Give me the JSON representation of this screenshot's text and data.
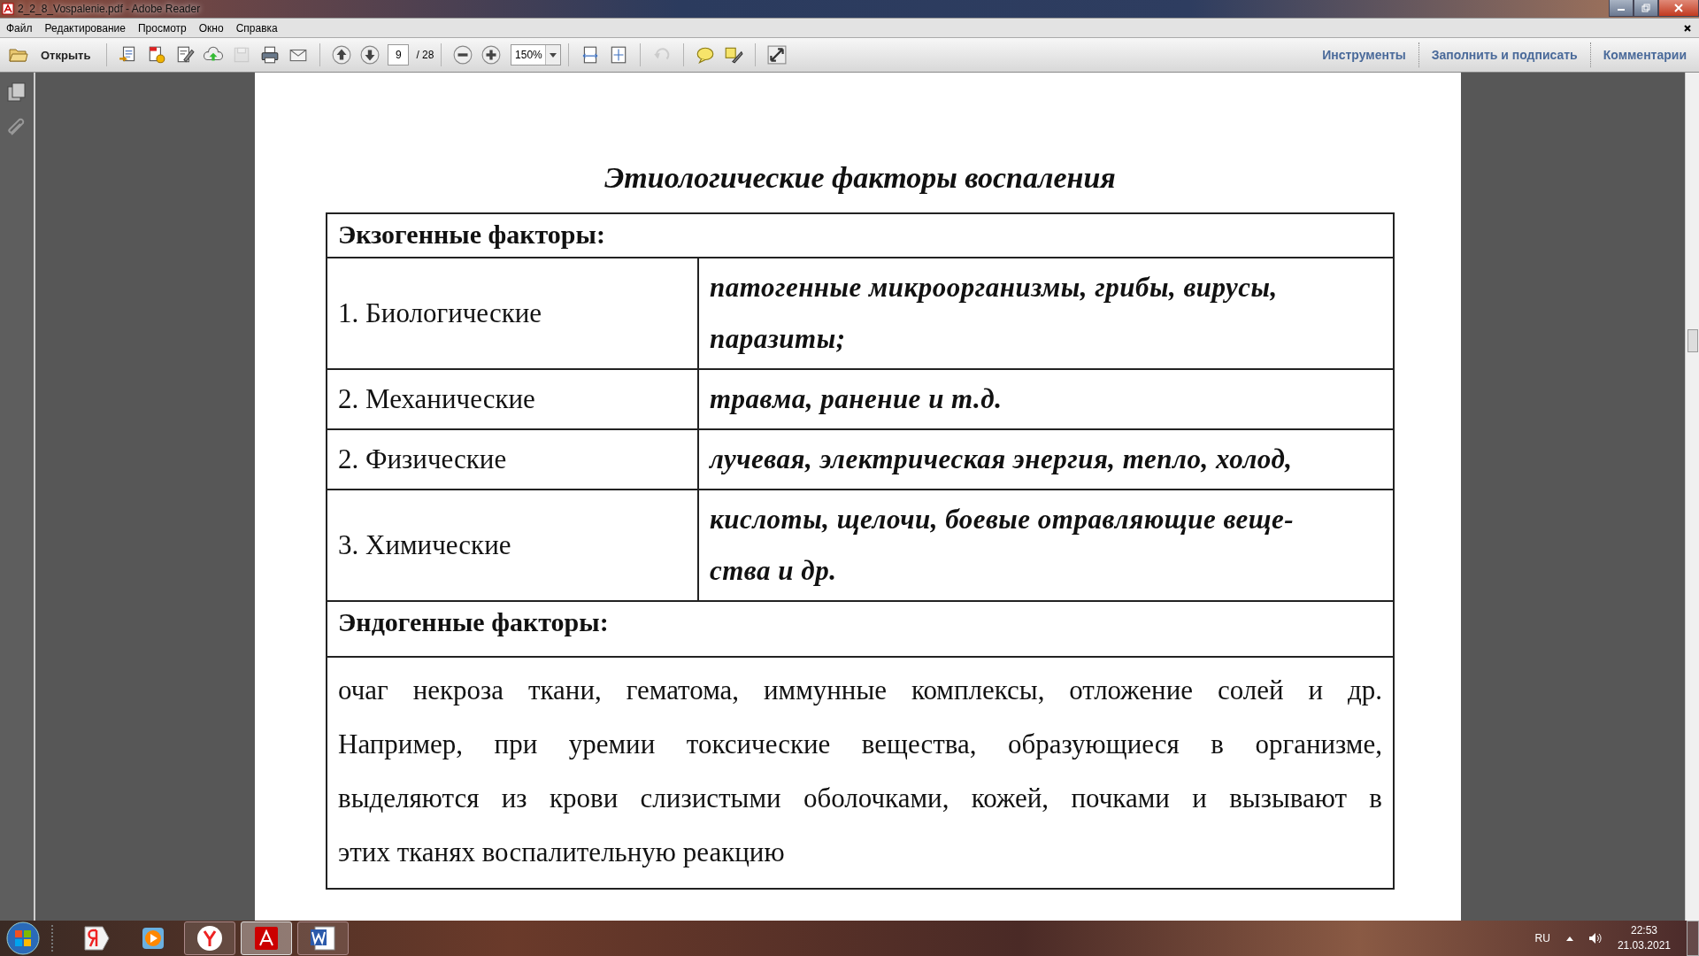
{
  "window": {
    "title": "2_2_8_Vospalenie.pdf - Adobe Reader"
  },
  "menu": [
    "Файл",
    "Редактирование",
    "Просмотр",
    "Окно",
    "Справка"
  ],
  "toolbar": {
    "open_label": "Открыть",
    "tools_a": [
      {
        "kind": "create",
        "disabled": false
      },
      {
        "kind": "convert",
        "disabled": false
      },
      {
        "kind": "edit",
        "disabled": false
      },
      {
        "kind": "upload",
        "disabled": false
      },
      {
        "kind": "save",
        "disabled": true
      },
      {
        "kind": "print",
        "disabled": false
      },
      {
        "kind": "mail",
        "disabled": false
      }
    ],
    "page": "9",
    "page_total": "/ 28",
    "zoom": "150%",
    "tools_b": [
      {
        "kind": "fitwidth",
        "disabled": false
      },
      {
        "kind": "fitpage",
        "disabled": false
      },
      {
        "kind": "undo",
        "disabled": true
      },
      {
        "kind": "comment",
        "disabled": false
      },
      {
        "kind": "highlight",
        "disabled": false
      },
      {
        "kind": "fullscreen",
        "disabled": false
      }
    ],
    "panels": [
      "Инструменты",
      "Заполнить и подписать",
      "Комментарии"
    ]
  },
  "document": {
    "heading": "Этиологические факторы воспаления",
    "exogenous_header": "Экзогенные факторы:",
    "rows": [
      {
        "factor": "1. Биологические",
        "description": [
          "патогенные  микроорганизмы, грибы, вирусы,",
          "паразиты;"
        ]
      },
      {
        "factor": "2. Механические",
        "description": [
          "травма, ранение и т.д."
        ]
      },
      {
        "factor": "2. Физические",
        "description": [
          "лучевая, электрическая энергия, тепло, холод,"
        ]
      },
      {
        "factor": "3. Химические",
        "description": [
          "кислоты, щелочи, боевые отравляющие веще-",
          "ства и др."
        ]
      }
    ],
    "endogenous_header": "Эндогенные факторы:",
    "endogenous_text": [
      "очаг некроза ткани, гематома, иммунные комплексы, отложение солей и др.",
      "Например, при уремии токсические вещества, образующиеся в организме,",
      "выделяются из крови слизистыми оболочками, кожей, почками и вызывают в",
      "этих тканях воспалительную реакцию"
    ]
  },
  "taskbar": {
    "apps": [
      {
        "kind": "yandex",
        "selected": false
      },
      {
        "kind": "media",
        "selected": false
      },
      {
        "kind": "browser",
        "selected": false
      },
      {
        "kind": "pdf",
        "selected": true
      },
      {
        "kind": "word",
        "selected": false
      }
    ],
    "language": "RU",
    "time": "22:53",
    "date": "21.03.2021"
  }
}
